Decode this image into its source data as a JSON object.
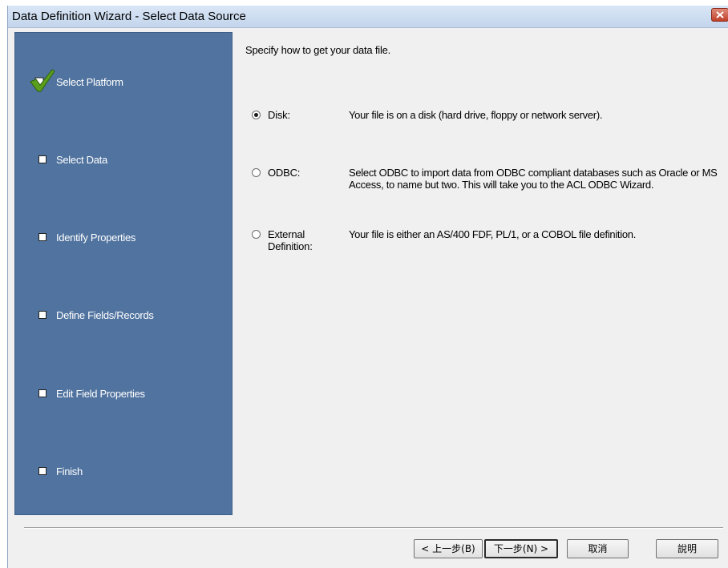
{
  "window": {
    "title": "Data Definition Wizard - Select Data Source"
  },
  "steps": [
    {
      "label": "Select Platform",
      "state": "completed"
    },
    {
      "label": "Select Data",
      "state": "pending"
    },
    {
      "label": "Identify Properties",
      "state": "pending"
    },
    {
      "label": "Define Fields/Records",
      "state": "pending"
    },
    {
      "label": "Edit Field Properties",
      "state": "pending"
    },
    {
      "label": "Finish",
      "state": "pending"
    }
  ],
  "main": {
    "prompt": "Specify how to get your data file.",
    "selected_option": "disk",
    "options": [
      {
        "id": "disk",
        "label": "Disk:",
        "description": "Your file is on a disk (hard drive, floppy or network server)."
      },
      {
        "id": "odbc",
        "label": "ODBC:",
        "description": "Select ODBC to import data from ODBC compliant databases such as Oracle or MS Access, to name but two. This will take you to the ACL ODBC Wizard."
      },
      {
        "id": "external",
        "label": "External Definition:",
        "description": "Your file is either an AS/400 FDF, PL/1, or a COBOL file definition."
      }
    ]
  },
  "buttons": {
    "back": "< 上一步(B)",
    "next": "下一步(N) >",
    "cancel": "取消",
    "help": "說明"
  },
  "colors": {
    "steps_panel": "#50739f",
    "window_bg": "#f0f0f0",
    "check_green": "#5a9e1e"
  },
  "icons": {
    "completed_step": "checkmark-icon",
    "pending_step": "checkbox-icon",
    "close": "close-icon"
  }
}
